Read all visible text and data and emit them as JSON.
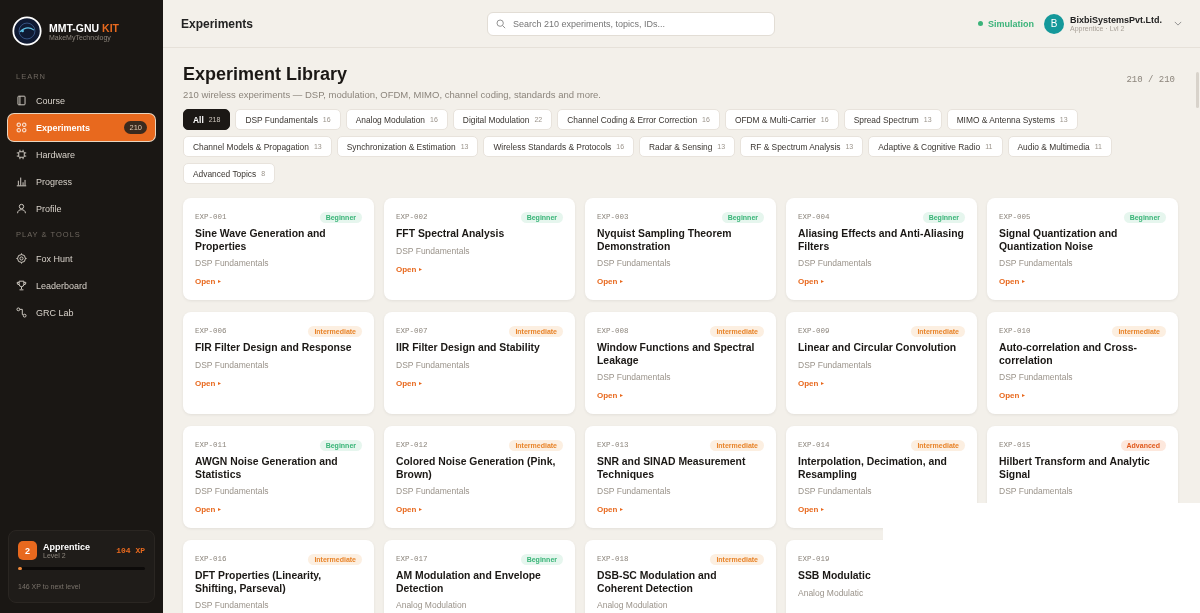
{
  "brand": {
    "name": "MMT-GNU",
    "accent": "KIT",
    "tagline": "MakeMyTechnology"
  },
  "sidebar": {
    "sections": [
      {
        "heading": "LEARN",
        "items": [
          {
            "label": "Course",
            "selected": false
          },
          {
            "label": "Experiments",
            "selected": true,
            "badge": "210"
          },
          {
            "label": "Hardware",
            "selected": false
          },
          {
            "label": "Progress",
            "selected": false
          },
          {
            "label": "Profile",
            "selected": false
          }
        ]
      },
      {
        "heading": "PLAY & TOOLS",
        "items": [
          {
            "label": "Fox Hunt",
            "selected": false
          },
          {
            "label": "Leaderboard",
            "selected": false
          },
          {
            "label": "GRC Lab",
            "selected": false
          }
        ]
      }
    ],
    "xp_card": {
      "level_number": "2",
      "rank": "Apprentice",
      "level_text": "Level 2",
      "xp": "104 XP",
      "level": 0.03,
      "caption": "146 XP to next level"
    }
  },
  "header": {
    "title": "Experiments",
    "search": {
      "placeholder": "Search 210 experiments, topics, IDs..."
    },
    "mode": "Simulation",
    "user": {
      "initial": "B",
      "name": "BixbiSystemsPvt.Ltd.",
      "role": "Apprentice · Lvl 2"
    }
  },
  "library": {
    "title": "Experiment Library",
    "count": "210 / 210",
    "subtitle": "210 wireless experiments — DSP, modulation, OFDM, MIMO, channel coding, standards and more.",
    "filters": [
      {
        "label": "All",
        "count": "218",
        "selected": true
      },
      {
        "label": "DSP Fundamentals",
        "count": "16",
        "selected": false
      },
      {
        "label": "Analog Modulation",
        "count": "16",
        "selected": false
      },
      {
        "label": "Digital Modulation",
        "count": "22",
        "selected": false
      },
      {
        "label": "Channel Coding & Error Correction",
        "count": "16",
        "selected": false
      },
      {
        "label": "OFDM & Multi-Carrier",
        "count": "16",
        "selected": false
      },
      {
        "label": "Spread Spectrum",
        "count": "13",
        "selected": false
      },
      {
        "label": "MIMO & Antenna Systems",
        "count": "13",
        "selected": false
      },
      {
        "label": "Channel Models & Propagation",
        "count": "13",
        "selected": false
      },
      {
        "label": "Synchronization & Estimation",
        "count": "13",
        "selected": false
      },
      {
        "label": "Wireless Standards & Protocols",
        "count": "16",
        "selected": false
      },
      {
        "label": "Radar & Sensing",
        "count": "13",
        "selected": false
      },
      {
        "label": "RF & Spectrum Analysis",
        "count": "13",
        "selected": false
      },
      {
        "label": "Adaptive & Cognitive Radio",
        "count": "11",
        "selected": false
      },
      {
        "label": "Audio & Multimedia",
        "count": "11",
        "selected": false
      },
      {
        "label": "Advanced Topics",
        "count": "8",
        "selected": false
      }
    ],
    "cards": [
      {
        "id": "EXP-001",
        "difficulty": "Beginner",
        "title": "Sine Wave Generation and Properties",
        "category": "DSP Fundamentals",
        "link": "Open"
      },
      {
        "id": "EXP-002",
        "difficulty": "Beginner",
        "title": "FFT Spectral Analysis",
        "category": "DSP Fundamentals",
        "link": "Open"
      },
      {
        "id": "EXP-003",
        "difficulty": "Beginner",
        "title": "Nyquist Sampling Theorem Demonstration",
        "category": "DSP Fundamentals",
        "link": "Open"
      },
      {
        "id": "EXP-004",
        "difficulty": "Beginner",
        "title": "Aliasing Effects and Anti-Aliasing Filters",
        "category": "DSP Fundamentals",
        "link": "Open"
      },
      {
        "id": "EXP-005",
        "difficulty": "Beginner",
        "title": "Signal Quantization and Quantization Noise",
        "category": "DSP Fundamentals",
        "link": "Open"
      },
      {
        "id": "EXP-006",
        "difficulty": "Intermediate",
        "title": "FIR Filter Design and Response",
        "category": "DSP Fundamentals",
        "link": "Open"
      },
      {
        "id": "EXP-007",
        "difficulty": "Intermediate",
        "title": "IIR Filter Design and Stability",
        "category": "DSP Fundamentals",
        "link": "Open"
      },
      {
        "id": "EXP-008",
        "difficulty": "Intermediate",
        "title": "Window Functions and Spectral Leakage",
        "category": "DSP Fundamentals",
        "link": "Open"
      },
      {
        "id": "EXP-009",
        "difficulty": "Intermediate",
        "title": "Linear and Circular Convolution",
        "category": "DSP Fundamentals",
        "link": "Open"
      },
      {
        "id": "EXP-010",
        "difficulty": "Intermediate",
        "title": "Auto-correlation and Cross-correlation",
        "category": "DSP Fundamentals",
        "link": "Open"
      },
      {
        "id": "EXP-011",
        "difficulty": "Beginner",
        "title": "AWGN Noise Generation and Statistics",
        "category": "DSP Fundamentals",
        "link": "Open"
      },
      {
        "id": "EXP-012",
        "difficulty": "Intermediate",
        "title": "Colored Noise Generation (Pink, Brown)",
        "category": "DSP Fundamentals",
        "link": "Open"
      },
      {
        "id": "EXP-013",
        "difficulty": "Intermediate",
        "title": "SNR and SINAD Measurement Techniques",
        "category": "DSP Fundamentals",
        "link": "Open"
      },
      {
        "id": "EXP-014",
        "difficulty": "Intermediate",
        "title": "Interpolation, Decimation, and Resampling",
        "category": "DSP Fundamentals",
        "link": "Open"
      },
      {
        "id": "EXP-015",
        "difficulty": "Advanced",
        "title": "Hilbert Transform and Analytic Signal",
        "category": "DSP Fundamentals"
      },
      {
        "id": "EXP-016",
        "difficulty": "Intermediate",
        "title": "DFT Properties (Linearity, Shifting, Parseval)",
        "category": "DSP Fundamentals"
      },
      {
        "id": "EXP-017",
        "difficulty": "Beginner",
        "title": "AM Modulation and Envelope Detection",
        "category": "Analog Modulation"
      },
      {
        "id": "EXP-018",
        "difficulty": "Intermediate",
        "title": "DSB-SC Modulation and Coherent Detection",
        "category": "Analog Modulation"
      },
      {
        "id": "EXP-019",
        "title": "SSB Modulatic",
        "category": "Analog Modulatic"
      }
    ]
  }
}
